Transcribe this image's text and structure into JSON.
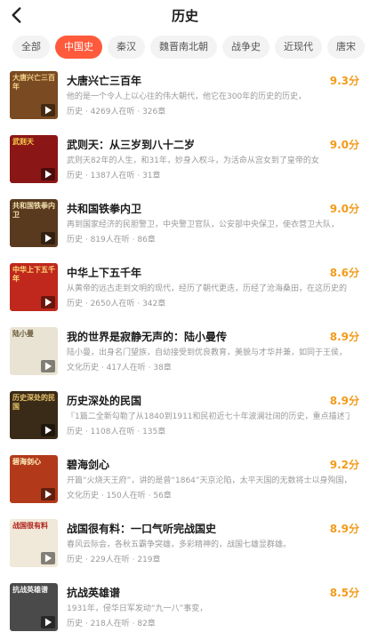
{
  "header": {
    "title": "历史"
  },
  "tabs": [
    {
      "label": "全部",
      "active": false
    },
    {
      "label": "中国史",
      "active": true
    },
    {
      "label": "秦汉",
      "active": false
    },
    {
      "label": "魏晋南北朝",
      "active": false
    },
    {
      "label": "战争史",
      "active": false
    },
    {
      "label": "近现代",
      "active": false
    },
    {
      "label": "唐宋",
      "active": false
    }
  ],
  "books": [
    {
      "title": "大唐兴亡三百年",
      "score": "9.3分",
      "desc": "他的是一个令人上以心往的伟大朝代，他它在300年的历史的历史，",
      "meta": "历史 · 4269人在听 · 326章",
      "cover_text": "大唐兴亡三百年",
      "cover_bg": "#7a4a22",
      "cover_fg": "#f3d28a"
    },
    {
      "title": "武则天：从三岁到八十二岁",
      "score": "9.0分",
      "desc": "武则天82年的人生，和31年，妙身入权斗，为活命从宫女到了皇帝的女",
      "meta": "历史 · 1387人在听 · 31章",
      "cover_text": "武则天",
      "cover_bg": "#8b1616",
      "cover_fg": "#f6d34b"
    },
    {
      "title": "共和国铁拳内卫",
      "score": "9.0分",
      "desc": "再到国家经济的民胆警卫，中央警卫官队，公安部中央保卫，使衣营卫大队，",
      "meta": "历史 · 819人在听 · 86章",
      "cover_text": "共和国铁拳内卫",
      "cover_bg": "#5a3a1e",
      "cover_fg": "#f0e0b0"
    },
    {
      "title": "中华上下五千年",
      "score": "8.6分",
      "desc": "从黄帝的远古走到文明的现代，经历了朝代更迭，历经了沧海桑田，在这历史的",
      "meta": "历史 · 2650人在听 · 342章",
      "cover_text": "中华上下五千年",
      "cover_bg": "#c0281d",
      "cover_fg": "#ffe27a"
    },
    {
      "title": "我的世界是寂静无声的：陆小曼传",
      "score": "8.9分",
      "desc": "陆小曼，出身名门望族，自幼接受到优良教育，美貌与才华并兼，如同于王侯，",
      "meta": "文化历史 · 417人在听 · 38章",
      "cover_text": "陆小曼",
      "cover_bg": "#e9e3d3",
      "cover_fg": "#6a5a3a"
    },
    {
      "title": "历史深处的民国",
      "score": "8.9分",
      "desc": "『1篇二全新勾勒了从1840到1911和民初近七十年波澜壮阔的历史，重点描述了清",
      "meta": "历史 · 1108人在听 · 135章",
      "cover_text": "历史深处的民国",
      "cover_bg": "#3a2a18",
      "cover_fg": "#e8c56a"
    },
    {
      "title": "碧海剑心",
      "score": "9.2分",
      "desc": "开篇“火烧天王府”，讲的是曾“1864”天京沦陷，太平天国的无数将士以身殉国，",
      "meta": "文化历史 · 150人在听 · 56章",
      "cover_text": "碧海剑心",
      "cover_bg": "#b23a1a",
      "cover_fg": "#fff0c0"
    },
    {
      "title": "战国很有料：一口气听完战国史",
      "score": "8.9分",
      "desc": "春风云际会，各秋五霸争突雄，多彩精神的，战国七雄显群雄。",
      "meta": "历史 · 229人在听 · 219章",
      "cover_text": "战国很有料",
      "cover_bg": "#f0e8d8",
      "cover_fg": "#b0201a"
    },
    {
      "title": "抗战英雄谱",
      "score": "8.5分",
      "desc": "1931年，侵华日军发动“九一八”事变，",
      "meta": "历史 · 218人在听 · 82章",
      "cover_text": "抗战英雄谱",
      "cover_bg": "#4a4a4a",
      "cover_fg": "#f2f2f2"
    }
  ]
}
